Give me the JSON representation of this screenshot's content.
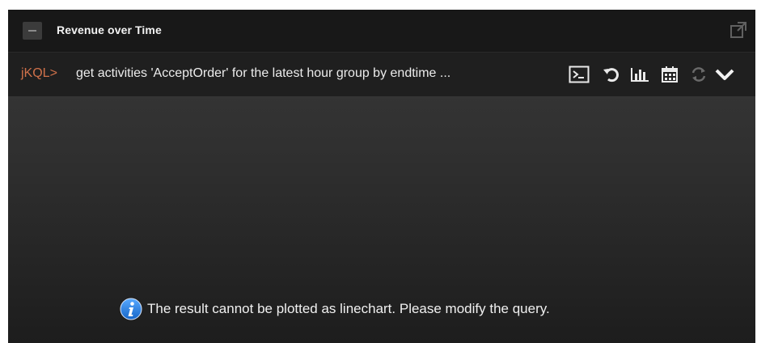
{
  "widget": {
    "title": "Revenue over Time"
  },
  "query": {
    "prompt": "jKQL>",
    "text": "get activities 'AcceptOrder' for the latest hour group by endtime ..."
  },
  "toolbar": {
    "icons": [
      "console-icon",
      "undo-icon",
      "bar-chart-icon",
      "calendar-icon",
      "refresh-icon",
      "chevron-down-icon"
    ]
  },
  "message": {
    "icon": "info-icon",
    "text": "The result cannot be plotted as linechart. Please modify the query."
  },
  "colors": {
    "prompt": "#d0714a",
    "info_blue": "#1e78d4",
    "background_dark": "#181818"
  }
}
